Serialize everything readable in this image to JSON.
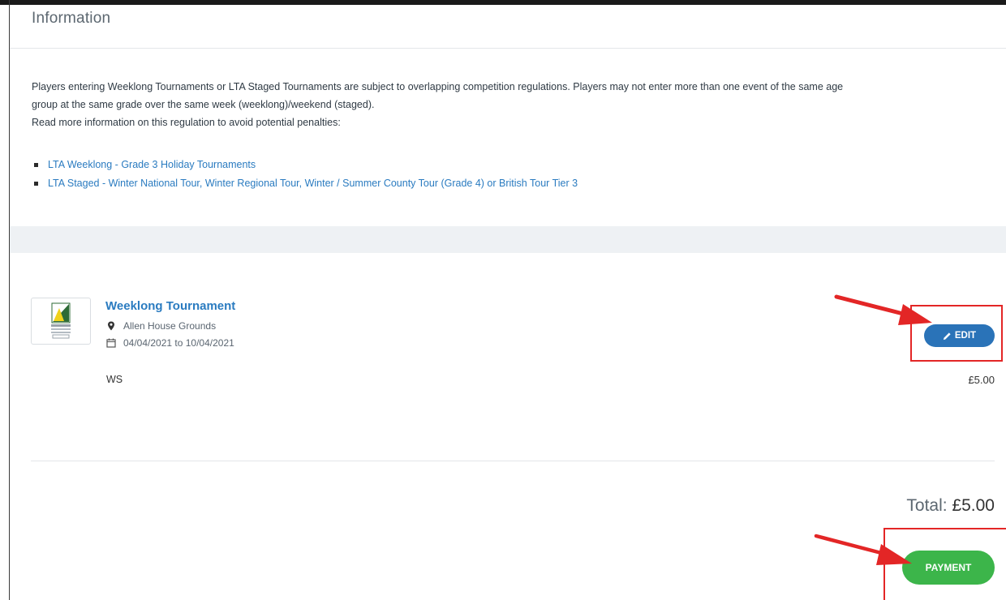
{
  "header": {
    "title": "Information"
  },
  "info": {
    "line1": "Players entering Weeklong Tournaments or LTA Staged Tournaments are subject to overlapping competition regulations. Players may not enter more than one event of the same age",
    "line2": "group at the same grade over the same week (weeklong)/weekend (staged).",
    "line3": "Read more information on this regulation to avoid potential penalties:"
  },
  "links": [
    {
      "label": "LTA Weeklong - Grade 3 Holiday Tournaments"
    },
    {
      "label": "LTA Staged - Winter National Tour, Winter Regional Tour, Winter / Summer County Tour (Grade 4) or British Tour Tier 3"
    }
  ],
  "tournament": {
    "name": "Weeklong Tournament",
    "venue": "Allen House Grounds",
    "dates": "04/04/2021 to 10/04/2021",
    "event_code": "WS",
    "price": "£5.00",
    "edit_label": "EDIT",
    "logo_icon": "club-logo-icon"
  },
  "summary": {
    "total_label": "Total:",
    "total_value": "£5.00",
    "payment_label": "PAYMENT"
  },
  "colors": {
    "link": "#2a7bc0",
    "edit_button": "#2a73b8",
    "payment_button": "#3cb54a",
    "annotation": "#e32626"
  }
}
